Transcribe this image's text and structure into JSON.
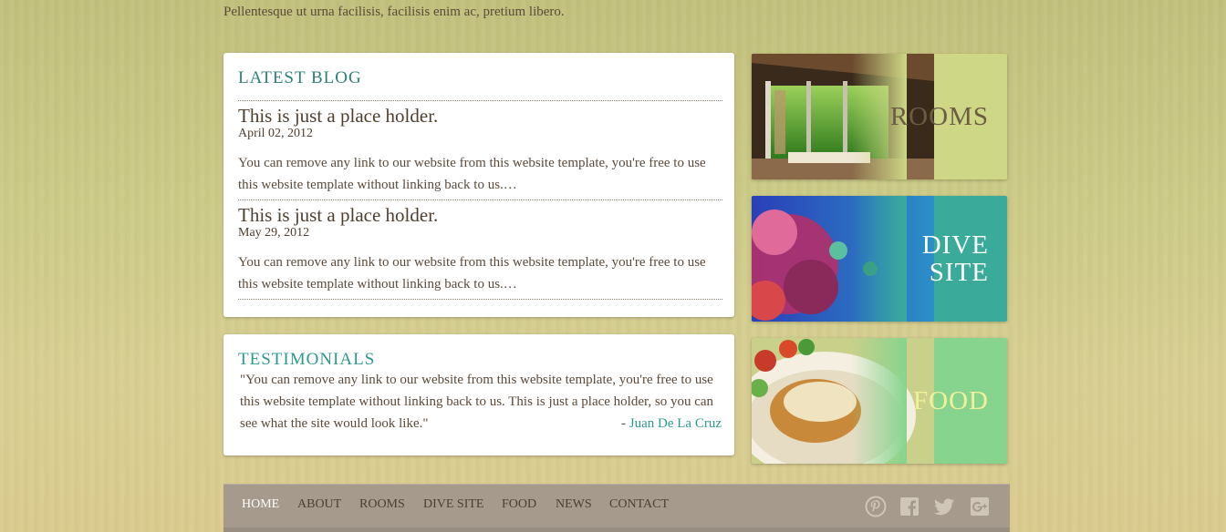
{
  "tagline": "Pellentesque ut urna facilisis, facilisis enim ac, pretium libero.",
  "blog": {
    "heading": "LATEST BLOG",
    "posts": [
      {
        "title": "This is just a place holder.",
        "date": "April 02, 2012",
        "text": "You can remove any link to our website from this website template, you're free to use this website template without linking back to us.…"
      },
      {
        "title": "This is just a place holder.",
        "date": "May 29, 2012",
        "text": "You can remove any link to our website from this website template, you're free to use this website template without linking back to us.…"
      }
    ]
  },
  "testimonials": {
    "heading": "TESTIMONIALS",
    "quote": "\"You can remove any link to our website from this website template, you're free to use this website template without linking back to us. This is just a place holder, so you can see what the site would look like.\"",
    "author_prefix": "- ",
    "author": "Juan De La Cruz"
  },
  "tiles": {
    "rooms": "ROOMS",
    "dive_line1": "DIVE",
    "dive_line2": "SITE",
    "food": "FOOD"
  },
  "nav": {
    "items": [
      "HOME",
      "ABOUT",
      "ROOMS",
      "DIVE SITE",
      "FOOD",
      "NEWS",
      "CONTACT"
    ],
    "active": "HOME"
  },
  "social": [
    "pinterest-icon",
    "facebook-icon",
    "twitter-icon",
    "google-plus-icon"
  ],
  "colors": {
    "teal_heading": "#2e8075",
    "link_teal": "#2e9a8c",
    "nav_bar": "#a59a8c",
    "rooms_tile": "#cdd786",
    "dive_tile": "#3aaa9a",
    "food_tile": "#86d48e"
  }
}
